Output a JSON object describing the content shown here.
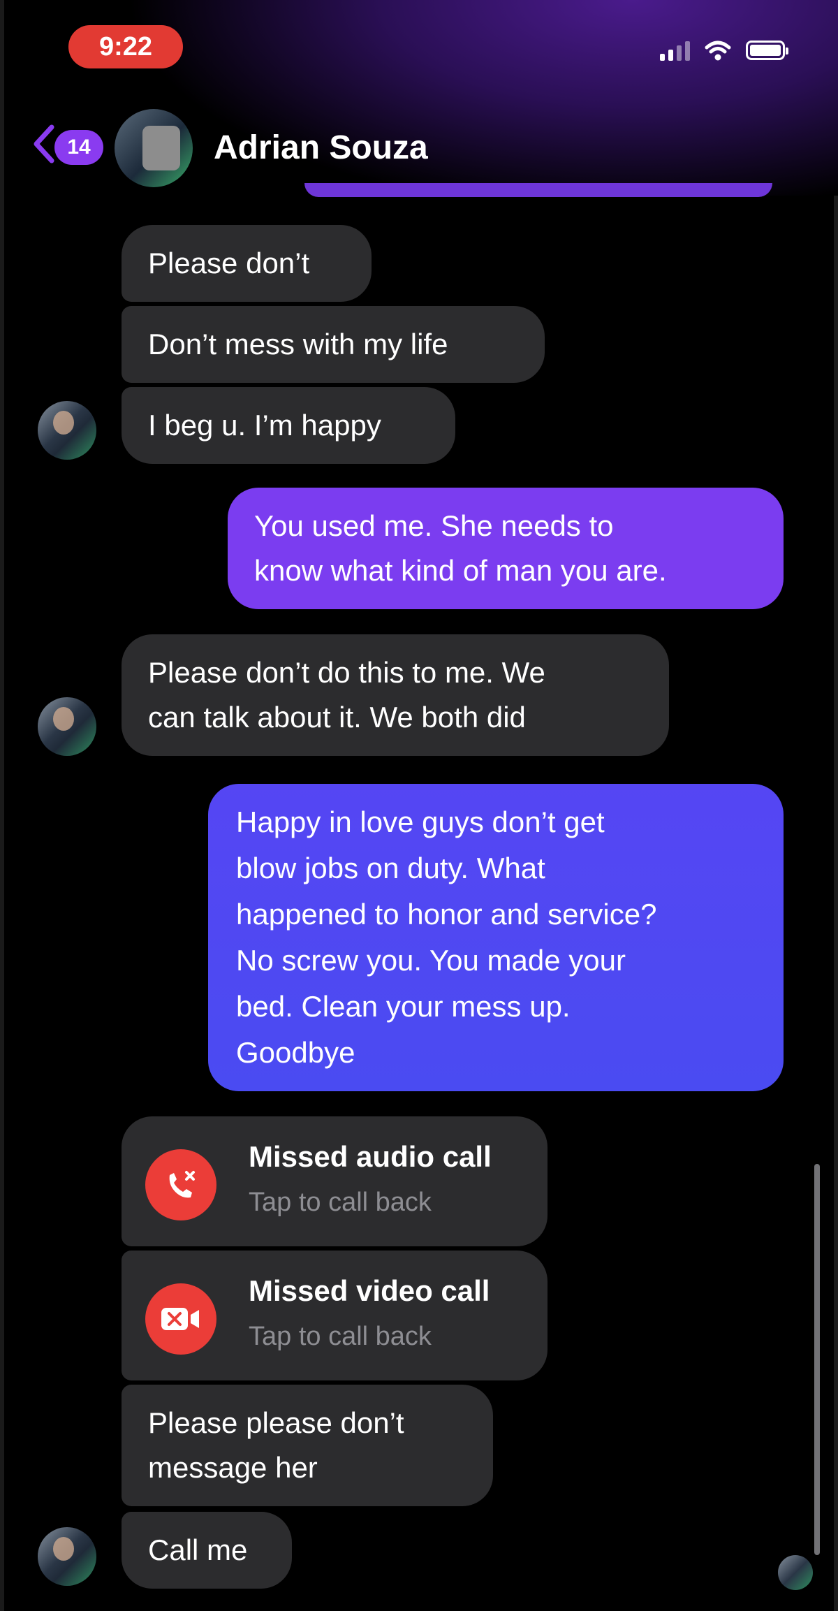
{
  "status_bar": {
    "time": "9:22"
  },
  "header": {
    "back_count": "14",
    "contact_name": "Adrian Souza"
  },
  "messages": [
    {
      "text": "Please don’t"
    },
    {
      "text": "Don’t mess with my life"
    },
    {
      "text": "I beg u. I’m happy"
    },
    {
      "line1": "You used me. She needs to",
      "line2": "know what kind of man you are."
    },
    {
      "line1": "Please don’t do this to me. We",
      "line2": "can talk about it. We both did"
    },
    {
      "lines": [
        "Happy in love guys don’t get",
        "blow jobs on duty. What",
        "happened to honor and service?",
        "No screw you. You made your",
        "bed. Clean your mess up.",
        "Goodbye"
      ]
    },
    {
      "line1": "Please please don’t",
      "line2": "message her"
    },
    {
      "text": "Call me"
    }
  ],
  "calls": [
    {
      "title": "Missed audio call",
      "subtitle": "Tap to call back",
      "icon": "missed-phone-icon"
    },
    {
      "title": "Missed video call",
      "subtitle": "Tap to call back",
      "icon": "missed-video-icon"
    }
  ],
  "colors": {
    "incoming": "#2c2c2e",
    "outgoing_purple": "#7b3df0",
    "outgoing_blue": "#4a4bf2",
    "missed_red": "#eb3d38",
    "accent": "#8a3bf0"
  }
}
